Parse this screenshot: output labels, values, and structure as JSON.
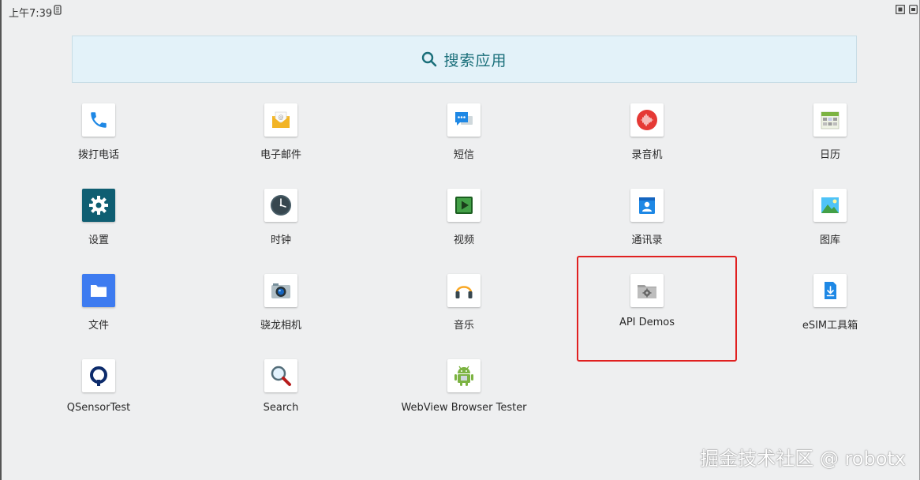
{
  "status_bar": {
    "time": "上午7:39"
  },
  "search": {
    "label": "搜索应用"
  },
  "apps": [
    {
      "label": "拨打电话",
      "icon": "phone-icon"
    },
    {
      "label": "电子邮件",
      "icon": "email-icon"
    },
    {
      "label": "短信",
      "icon": "messages-icon"
    },
    {
      "label": "录音机",
      "icon": "recorder-icon"
    },
    {
      "label": "日历",
      "icon": "calendar-icon"
    },
    {
      "label": "设置",
      "icon": "settings-icon"
    },
    {
      "label": "时钟",
      "icon": "clock-icon"
    },
    {
      "label": "视频",
      "icon": "video-icon"
    },
    {
      "label": "通讯录",
      "icon": "contacts-icon"
    },
    {
      "label": "图库",
      "icon": "gallery-icon"
    },
    {
      "label": "文件",
      "icon": "files-icon"
    },
    {
      "label": "骁龙相机",
      "icon": "camera-icon"
    },
    {
      "label": "音乐",
      "icon": "music-icon"
    },
    {
      "label": "API Demos",
      "icon": "api-demos-icon"
    },
    {
      "label": "eSIM工具箱",
      "icon": "esim-download-icon"
    },
    {
      "label": "QSensorTest",
      "icon": "qsensor-icon"
    },
    {
      "label": "Search",
      "icon": "search-app-icon"
    },
    {
      "label": "WebView Browser Tester",
      "icon": "android-icon"
    }
  ],
  "watermark": {
    "text": "掘金技术社区 @ robotx"
  },
  "colors": {
    "highlight": "#e02020",
    "search_bg": "#e3f2f9",
    "search_text": "#1a6f7a"
  }
}
